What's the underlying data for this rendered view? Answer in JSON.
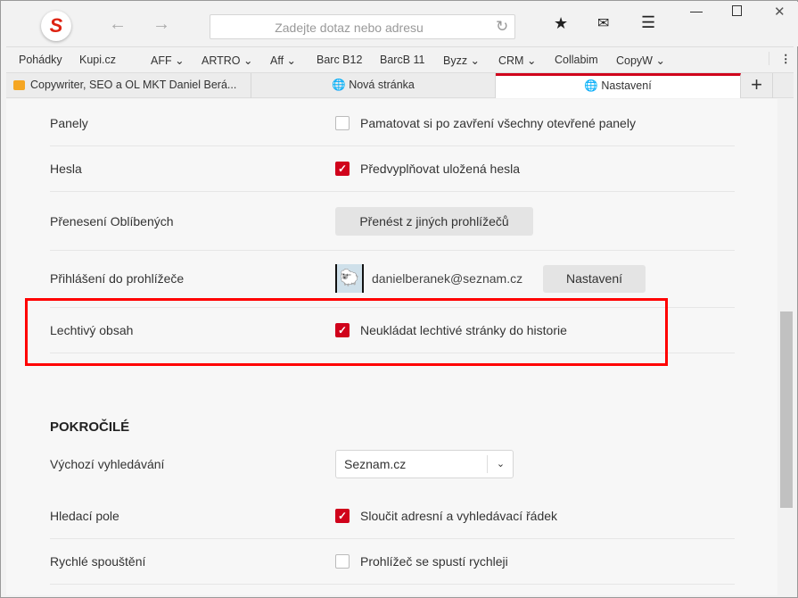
{
  "toolbar": {
    "address_placeholder": "Zadejte dotaz nebo adresu",
    "logo": "S"
  },
  "bookmarks": [
    "Pohádky",
    "Kupi.cz",
    "AFF ⌄",
    "ARTRO ⌄",
    "Aff ⌄",
    "Barc B12",
    "BarcB 11",
    "Byzz ⌄",
    "CRM ⌄",
    "Collabim",
    "CopyW ⌄"
  ],
  "tabs": [
    "Copywriter, SEO a OL MKT Daniel Berá...",
    "Nová stránka",
    "Nastavení"
  ],
  "settings": {
    "panels": {
      "label": "Panely",
      "option": "Pamatovat si po zavření všechny otevřené panely",
      "checked": false
    },
    "passwords": {
      "label": "Hesla",
      "option": "Předvyplňovat uložená hesla",
      "checked": true
    },
    "favorites": {
      "label": "Přenesení Oblíbených",
      "button": "Přenést z jiných prohlížečů"
    },
    "login": {
      "label": "Přihlášení do prohlížeče",
      "email": "danielberanek@seznam.cz",
      "button": "Nastavení"
    },
    "adult": {
      "label": "Lechtivý obsah",
      "option": "Neukládat lechtivé stránky do historie",
      "checked": true
    },
    "advanced_heading": "POKROČILÉ",
    "search": {
      "label": "Výchozí vyhledávání",
      "value": "Seznam.cz"
    },
    "searchbar": {
      "label": "Hledací pole",
      "option": "Sloučit adresní a vyhledávací řádek",
      "checked": true
    },
    "quickstart": {
      "label": "Rychlé spouštění",
      "option": "Prohlížeč se spustí rychleji",
      "checked": false
    }
  }
}
